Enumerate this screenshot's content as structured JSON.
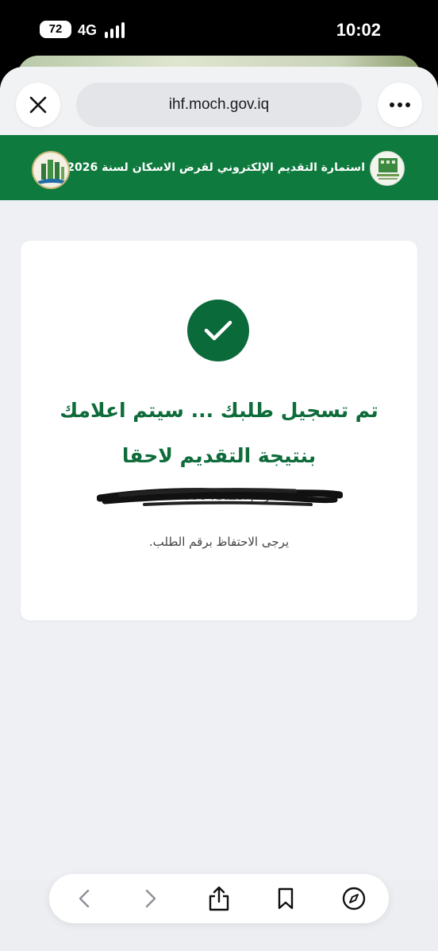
{
  "status_bar": {
    "battery": "72",
    "network": "4G",
    "time": "10:02"
  },
  "browser": {
    "url": "ihf.moch.gov.iq",
    "icons": {
      "close": "close-icon",
      "more": "more-icon",
      "back": "chevron-left-icon",
      "forward": "chevron-right-icon",
      "share": "share-icon",
      "bookmark": "bookmark-icon",
      "compass": "compass-icon"
    }
  },
  "header": {
    "title": "استمارة التقديم الإلكتروني لقرض الاسكان لسنة 2026",
    "background_color": "#0e7a3e",
    "logo_left": "ministry-logo",
    "logo_right": "iraqi-housing-fund-logo"
  },
  "confirmation": {
    "icon": "check-circle-icon",
    "line1": "تم تسجيل طلبك ... سيتم اعلامك",
    "line2": "بنتيجة التقديم لاحقا",
    "request_number_label": "رقم الطلب: 998",
    "note": "يرجى الاحتفاظ برقم الطلب.",
    "accent_color": "#0e6b3a"
  }
}
